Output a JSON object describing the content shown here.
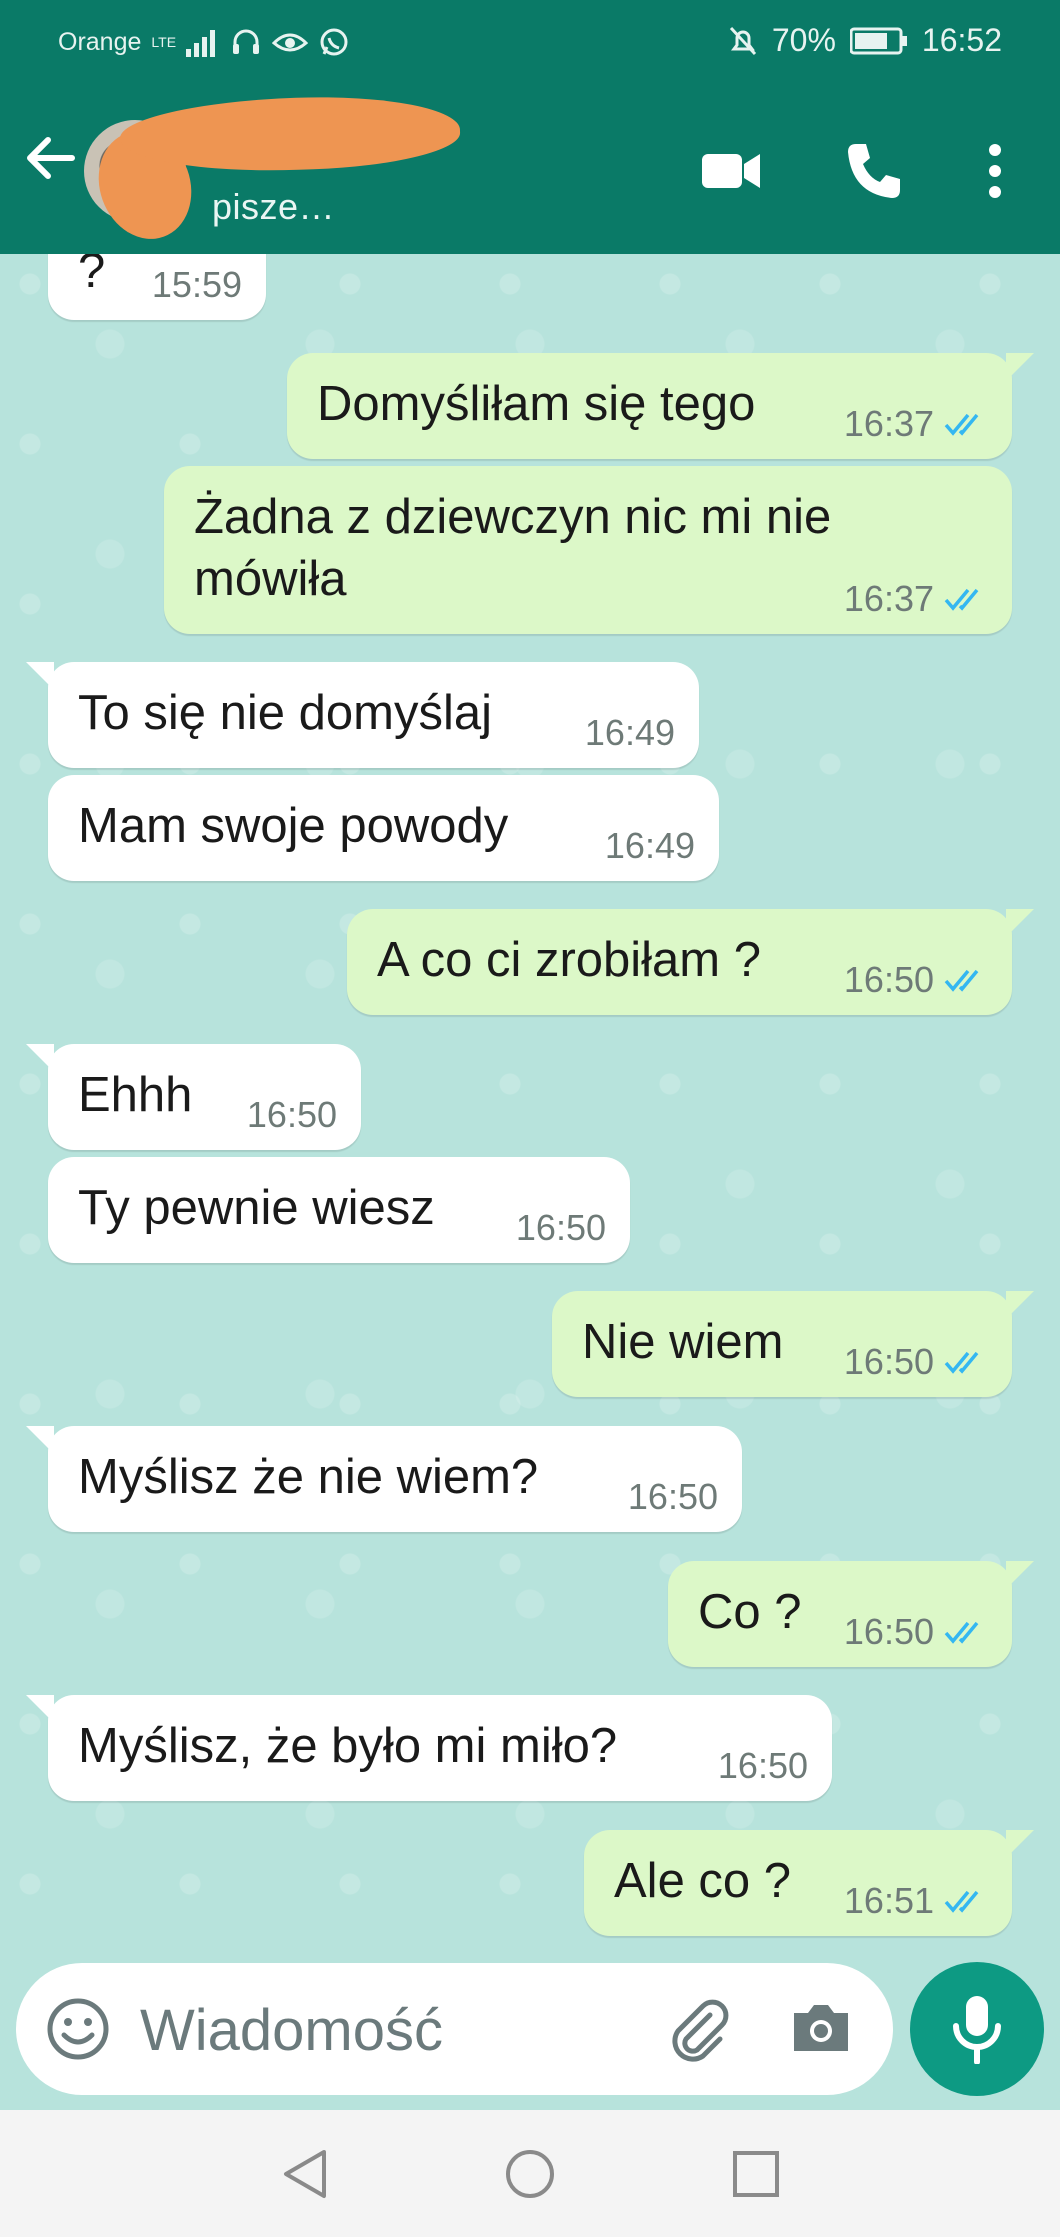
{
  "status_bar": {
    "carrier": "Orange",
    "network": "LTE",
    "battery": "70%",
    "time": "16:52"
  },
  "header": {
    "status": "pisze…",
    "icons": [
      "back-arrow-icon",
      "video-call-icon",
      "phone-icon",
      "more-vert-icon"
    ]
  },
  "messages": [
    {
      "dir": "in",
      "text": "?",
      "time": "15:59"
    },
    {
      "dir": "out",
      "text": "Domyśliłam się tego",
      "time": "16:37",
      "read": true
    },
    {
      "dir": "out",
      "text": "Żadna z dziewczyn nic mi nie",
      "text2": "mówiła",
      "time": "16:37",
      "read": true
    },
    {
      "dir": "in",
      "text": "To się nie domyślaj",
      "time": "16:49"
    },
    {
      "dir": "in",
      "text": "Mam swoje powody",
      "time": "16:49"
    },
    {
      "dir": "out",
      "text": "A co ci zrobiłam ?",
      "time": "16:50",
      "read": true
    },
    {
      "dir": "in",
      "text": "Ehhh",
      "time": "16:50"
    },
    {
      "dir": "in",
      "text": "Ty pewnie wiesz",
      "time": "16:50"
    },
    {
      "dir": "out",
      "text": "Nie wiem",
      "time": "16:50",
      "read": true
    },
    {
      "dir": "in",
      "text": "Myślisz że nie wiem?",
      "time": "16:50"
    },
    {
      "dir": "out",
      "text": "Co ?",
      "time": "16:50",
      "read": true
    },
    {
      "dir": "in",
      "text": "Myślisz, że było mi miło?",
      "time": "16:50"
    },
    {
      "dir": "out",
      "text": "Ale co ?",
      "time": "16:51",
      "read": true
    }
  ],
  "composer": {
    "placeholder": "Wiadomość"
  },
  "colors": {
    "header": "#0a7a67",
    "chat_bg": "#b7e3dc",
    "outgoing_bubble": "#dcf8c8",
    "incoming_bubble": "#ffffff",
    "read_ticks": "#34b7f1",
    "mic_button": "#0d9a83"
  }
}
